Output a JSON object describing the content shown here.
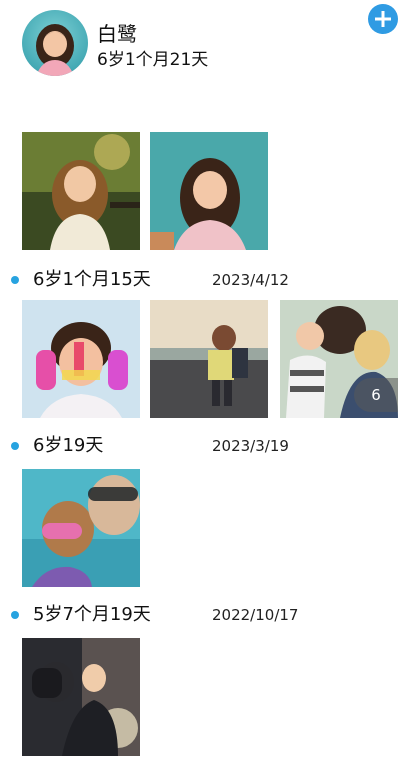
{
  "profile": {
    "name": "白鹭",
    "age": "6岁1个月21天"
  },
  "sections": [
    {
      "age": "6岁1个月15天",
      "date": "2023/4/12",
      "more_count": "6"
    },
    {
      "age": "6岁19天",
      "date": "2023/3/19"
    },
    {
      "age": "5岁7个月19天",
      "date": "2022/10/17"
    }
  ],
  "colors": {
    "accent": "#2f9be3",
    "bullet": "#27a3e0"
  },
  "icons": {
    "add": "plus-icon"
  }
}
